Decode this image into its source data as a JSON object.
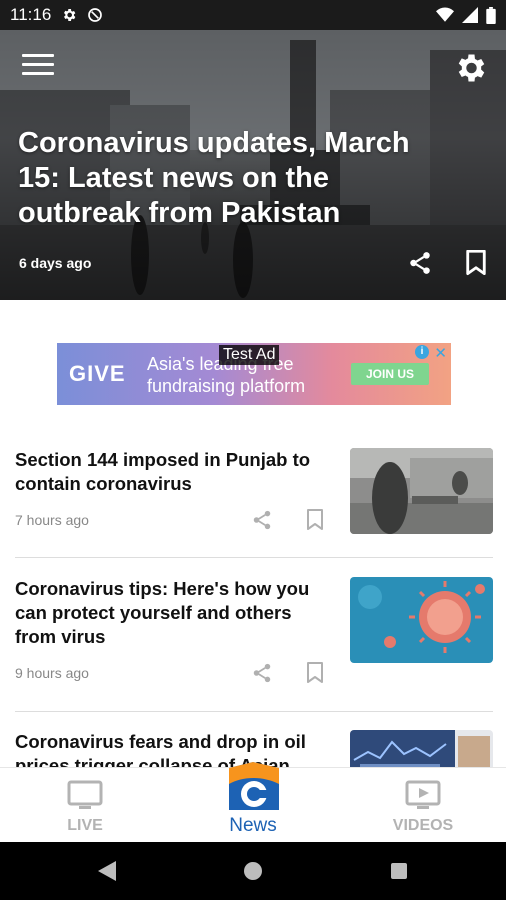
{
  "status_bar": {
    "time": "11:16"
  },
  "hero": {
    "title": "Coronavirus updates, March 15: Latest news on the outbreak from Pakistan",
    "time": "6 days ago"
  },
  "ad": {
    "label": "Test Ad",
    "brand": "GIVE",
    "text": "Asia's leading free fundraising platform",
    "cta": "JOIN US"
  },
  "articles": [
    {
      "title": "Section 144 imposed in Punjab to contain coronavirus",
      "time": "7 hours ago"
    },
    {
      "title": "Coronavirus tips: Here's how you can protect yourself and others from virus",
      "time": "9 hours ago"
    },
    {
      "title": "Coronavirus fears and drop in oil prices trigger collapse of Asian",
      "time": ""
    }
  ],
  "bottom_nav": {
    "live": "LIVE",
    "news": "News",
    "videos": "VIDEOS"
  },
  "colors": {
    "status_bar": "#1b1b1b",
    "news_logo_blue": "#1d62b4",
    "news_logo_orange": "#f7941d",
    "nav_inactive": "#b3b3b3"
  },
  "icons": {
    "menu": "hamburger-menu-icon",
    "settings": "gear-icon",
    "share": "share-icon",
    "bookmark": "bookmark-icon",
    "live": "tv-icon",
    "videos": "video-play-icon"
  }
}
